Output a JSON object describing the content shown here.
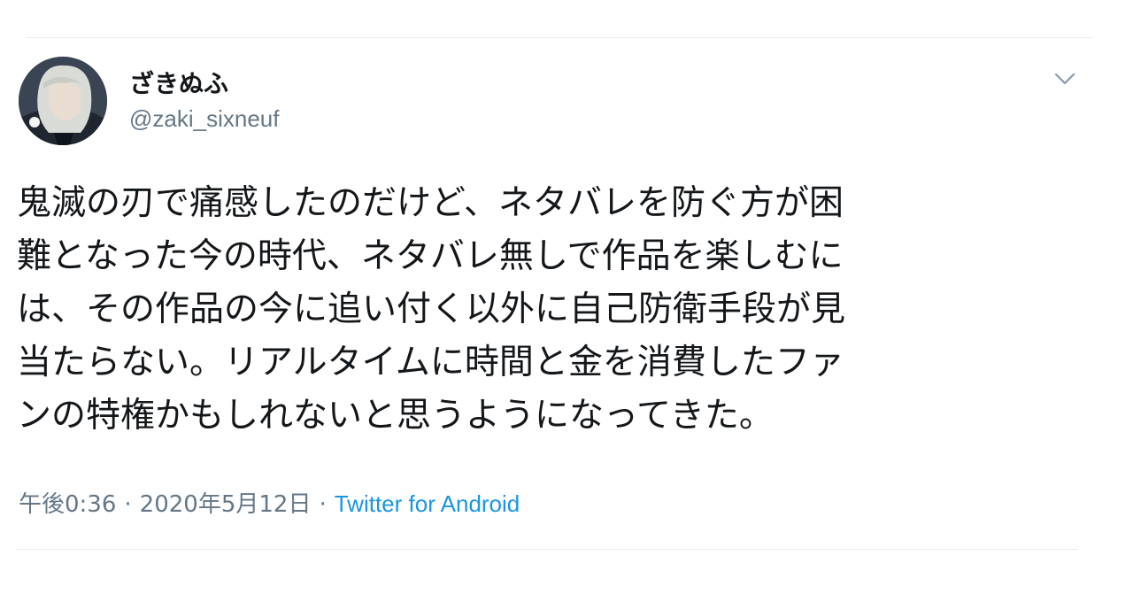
{
  "user": {
    "display_name": "ざきぬふ",
    "handle": "@zaki_sixneuf"
  },
  "tweet": {
    "lines": [
      "鬼滅の刃で痛感したのだけど、ネタバレを防ぐ方が困",
      "難となった今の時代、ネタバレ無しで作品を楽しむに",
      "は、その作品の今に追い付く以外に自己防衛手段が見",
      "当たらない。リアルタイムに時間と金を消費したファ",
      "ンの特権かもしれないと思うようになってきた。"
    ]
  },
  "meta": {
    "time": "午後0:36",
    "separator": "·",
    "date": "2020年5月12日",
    "source": "Twitter for Android"
  },
  "icons": {
    "menu": "chevron-down-icon",
    "avatar": "profile-avatar"
  },
  "colors": {
    "text": "#14171a",
    "secondary": "#657786",
    "link": "#1b95e0",
    "divider": "#e6ecf0"
  }
}
